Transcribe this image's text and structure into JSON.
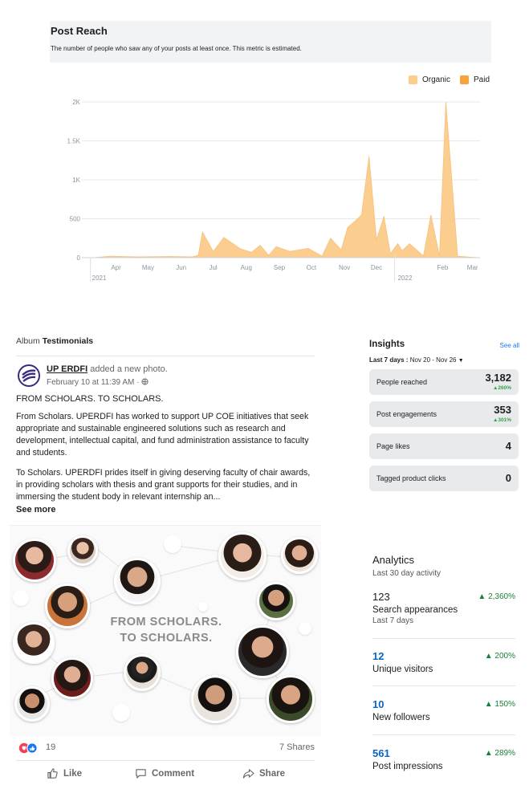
{
  "reach_chart": {
    "title": "Post Reach",
    "subtitle": "The number of people who saw any of your posts at least once. This metric is estimated.",
    "legend": [
      {
        "name": "Organic",
        "color": "#fbcd8e"
      },
      {
        "name": "Paid",
        "color": "#f7a23b"
      }
    ],
    "y_ticks": [
      "0",
      "500",
      "1K",
      "1.5K",
      "2K"
    ],
    "x_months": [
      "Apr",
      "May",
      "Jun",
      "Jul",
      "Aug",
      "Sep",
      "Oct",
      "Nov",
      "Dec",
      "Jan",
      "Feb",
      "Mar"
    ],
    "years": [
      "2021",
      "2022"
    ]
  },
  "chart_data": {
    "type": "area",
    "title": "Post Reach",
    "ylim": [
      0,
      2000
    ],
    "series": [
      {
        "name": "Organic",
        "x": [
          "2021-03-25",
          "2021-04-10",
          "2021-05-05",
          "2021-06-05",
          "2021-06-25",
          "2021-07-01",
          "2021-07-05",
          "2021-07-15",
          "2021-07-25",
          "2021-08-10",
          "2021-08-20",
          "2021-08-28",
          "2021-09-05",
          "2021-09-12",
          "2021-09-25",
          "2021-10-12",
          "2021-10-25",
          "2021-11-02",
          "2021-11-12",
          "2021-11-18",
          "2021-11-25",
          "2021-12-01",
          "2021-12-08",
          "2021-12-15",
          "2021-12-22",
          "2021-12-28",
          "2022-01-04",
          "2022-01-08",
          "2022-01-15",
          "2022-01-28",
          "2022-02-04",
          "2022-02-12",
          "2022-02-18",
          "2022-03-01",
          "2022-03-20"
        ],
        "values": [
          0,
          20,
          10,
          15,
          10,
          30,
          330,
          80,
          260,
          110,
          70,
          160,
          30,
          140,
          80,
          120,
          20,
          250,
          100,
          390,
          470,
          550,
          1300,
          230,
          530,
          50,
          180,
          90,
          180,
          20,
          550,
          20,
          2000,
          20,
          0
        ]
      },
      {
        "name": "Paid",
        "x": [],
        "values": []
      }
    ]
  },
  "post": {
    "album_prefix": "Album",
    "album_name": "Testimonials",
    "poster": "UP ERDFI",
    "action": "added a new photo.",
    "time": "February 10 at 11:39 AM · ",
    "headline": "FROM SCHOLARS. TO SCHOLARS.",
    "paragraph1": "From Scholars. UPERDFI has worked to support UP COE initiatives that seek appropriate and sustainable engineered solutions such as research and development, intellectual capital, and fund administration assistance to faculty and students.",
    "paragraph2": "To Scholars. UPERDFI prides itself in giving deserving faculty of chair awards, in providing scholars with thesis and grant supports for their studies, and in immersing the student body in relevant internship an...",
    "see_more": "See more",
    "image_text_line1": "FROM SCHOLARS.",
    "image_text_line2": "TO SCHOLARS.",
    "reaction_count": "19",
    "shares": "7 Shares",
    "actions": {
      "like": "Like",
      "comment": "Comment",
      "share": "Share"
    }
  },
  "insights": {
    "title": "Insights",
    "see_all": "See all",
    "range_label": "Last 7 days : ",
    "range_value": "Nov 20 - Nov 26",
    "rows": [
      {
        "label": "People reached",
        "value": "3,182",
        "change": "▲260%"
      },
      {
        "label": "Post engagements",
        "value": "353",
        "change": "▲301%"
      },
      {
        "label": "Page likes",
        "value": "4",
        "change": ""
      },
      {
        "label": "Tagged product clicks",
        "value": "0",
        "change": ""
      }
    ]
  },
  "analytics": {
    "title": "Analytics",
    "subtitle": "Last 30 day activity",
    "items": [
      {
        "value": "123",
        "label": "Search appearances",
        "note": "Last 7 days",
        "change": "▲ 2,360%"
      },
      {
        "value": "12",
        "label": "Unique visitors",
        "note": "",
        "change": "▲ 200%"
      },
      {
        "value": "10",
        "label": "New followers",
        "note": "",
        "change": "▲ 150%"
      },
      {
        "value": "561",
        "label": "Post impressions",
        "note": "",
        "change": "▲ 289%"
      }
    ]
  }
}
